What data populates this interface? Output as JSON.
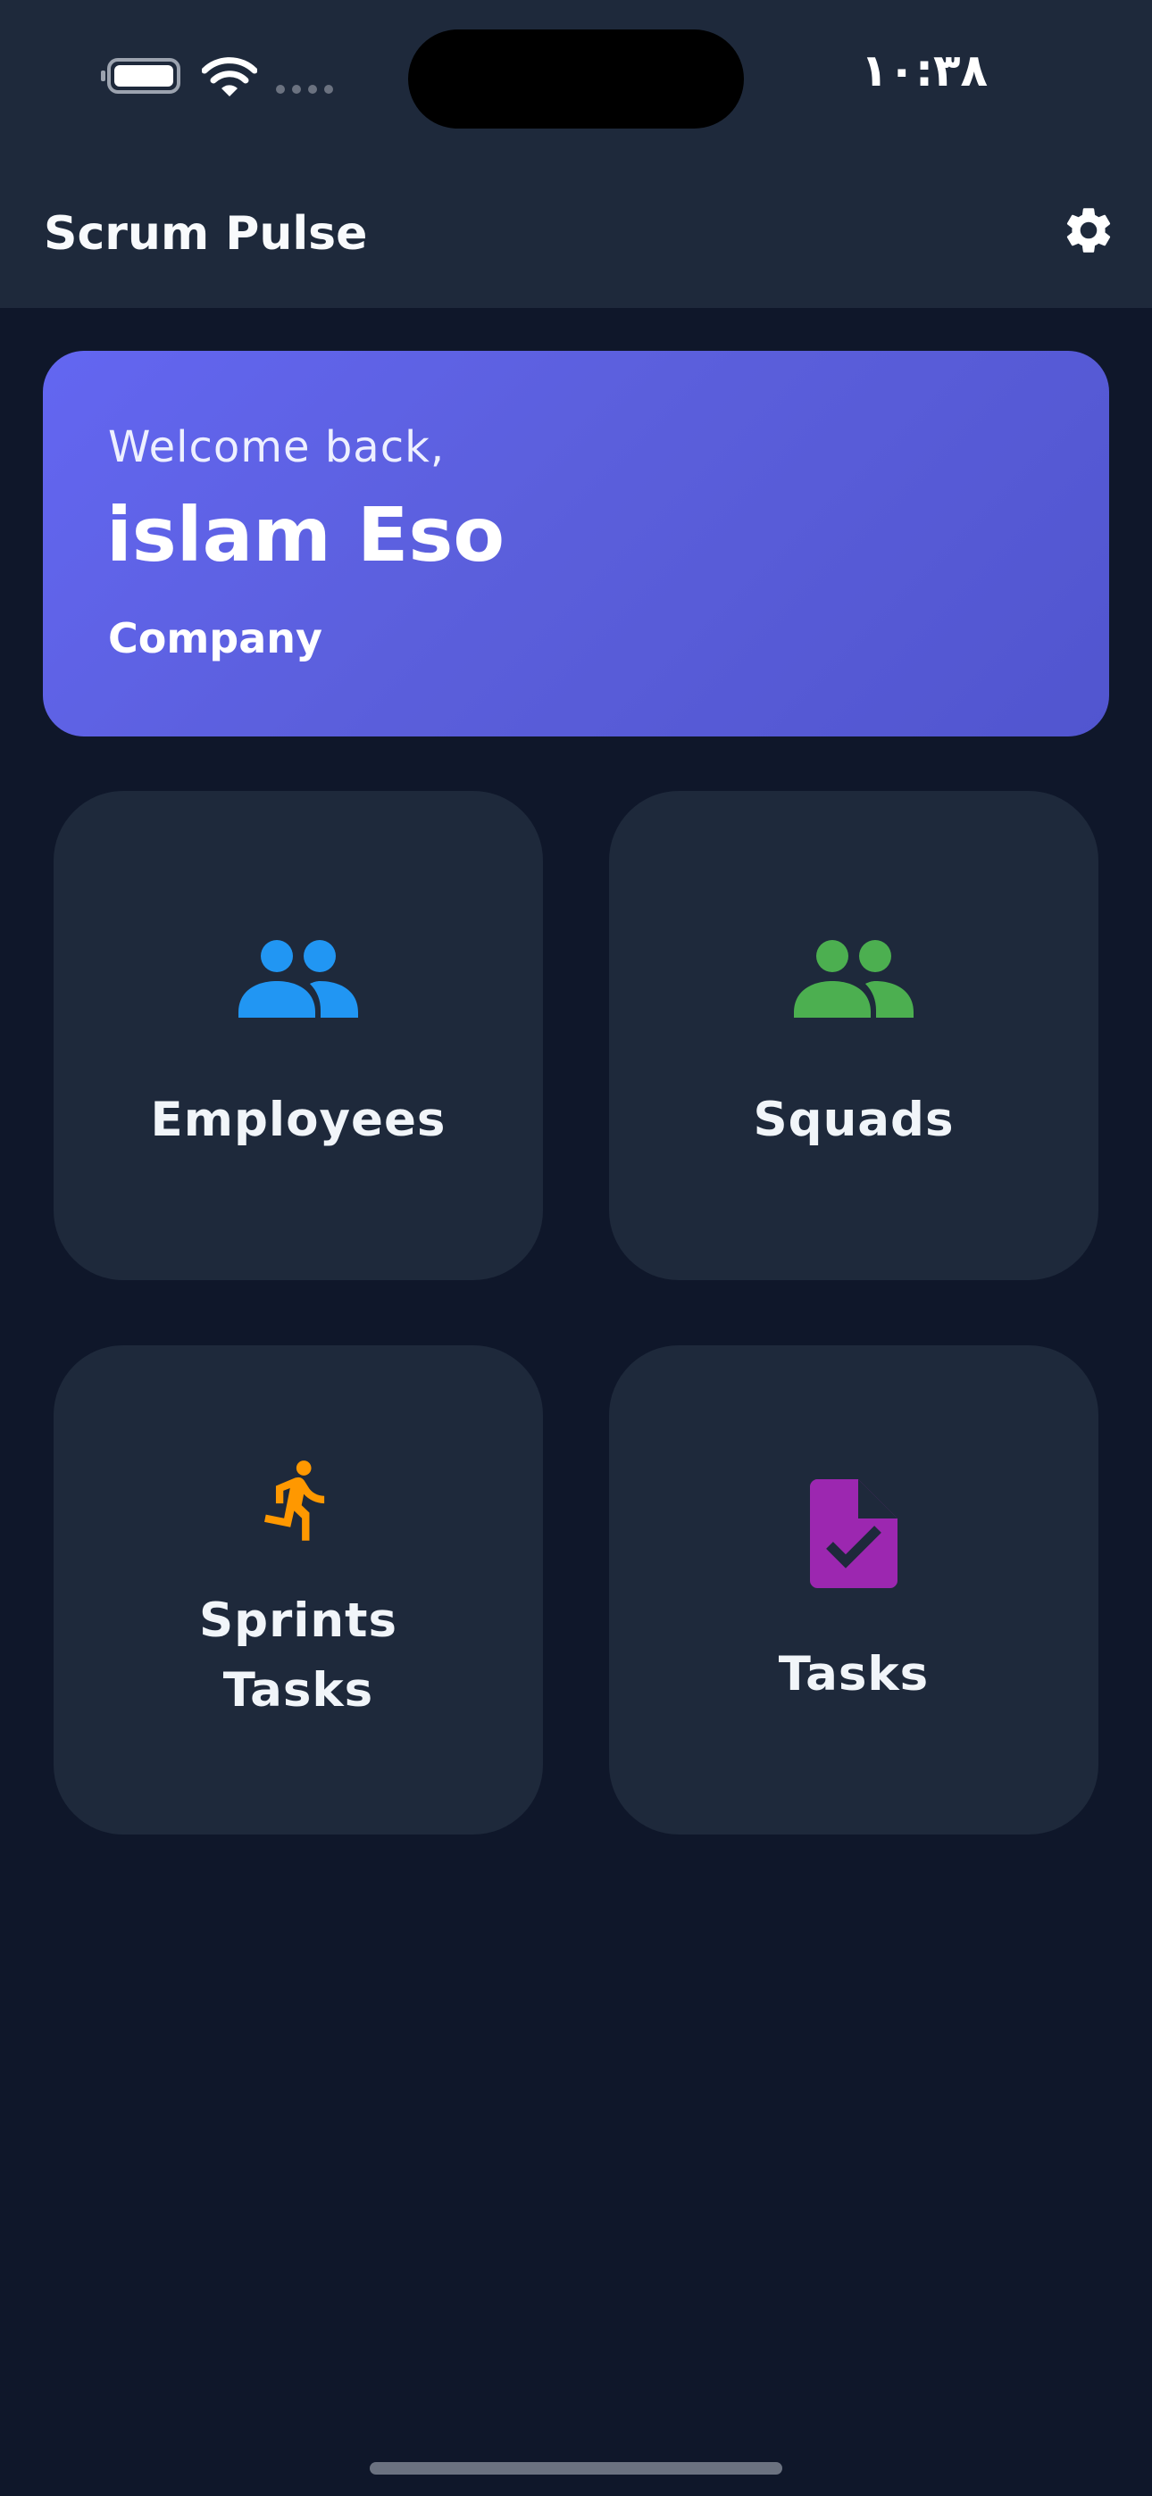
{
  "status_bar": {
    "time": "١٠:٣٨"
  },
  "app_bar": {
    "title": "Scrum Pulse",
    "settings_icon": "gear-icon"
  },
  "welcome": {
    "greeting": "Welcome back,",
    "name": "islam Eso",
    "company": "Company"
  },
  "tiles": [
    {
      "label": "Employees",
      "icon": "people-icon",
      "color": "#2196f3"
    },
    {
      "label": "Squads",
      "icon": "people-icon",
      "color": "#4caf50"
    },
    {
      "label": "Sprints Tasks",
      "line1": "Sprints",
      "line2": "Tasks",
      "icon": "running-person-icon",
      "color": "#ff9800"
    },
    {
      "label": "Tasks",
      "icon": "task-document-icon",
      "color": "#9c27b0"
    }
  ],
  "colors": {
    "background": "#0f172a",
    "surface": "#1e293b",
    "accent": "#6366f1"
  }
}
